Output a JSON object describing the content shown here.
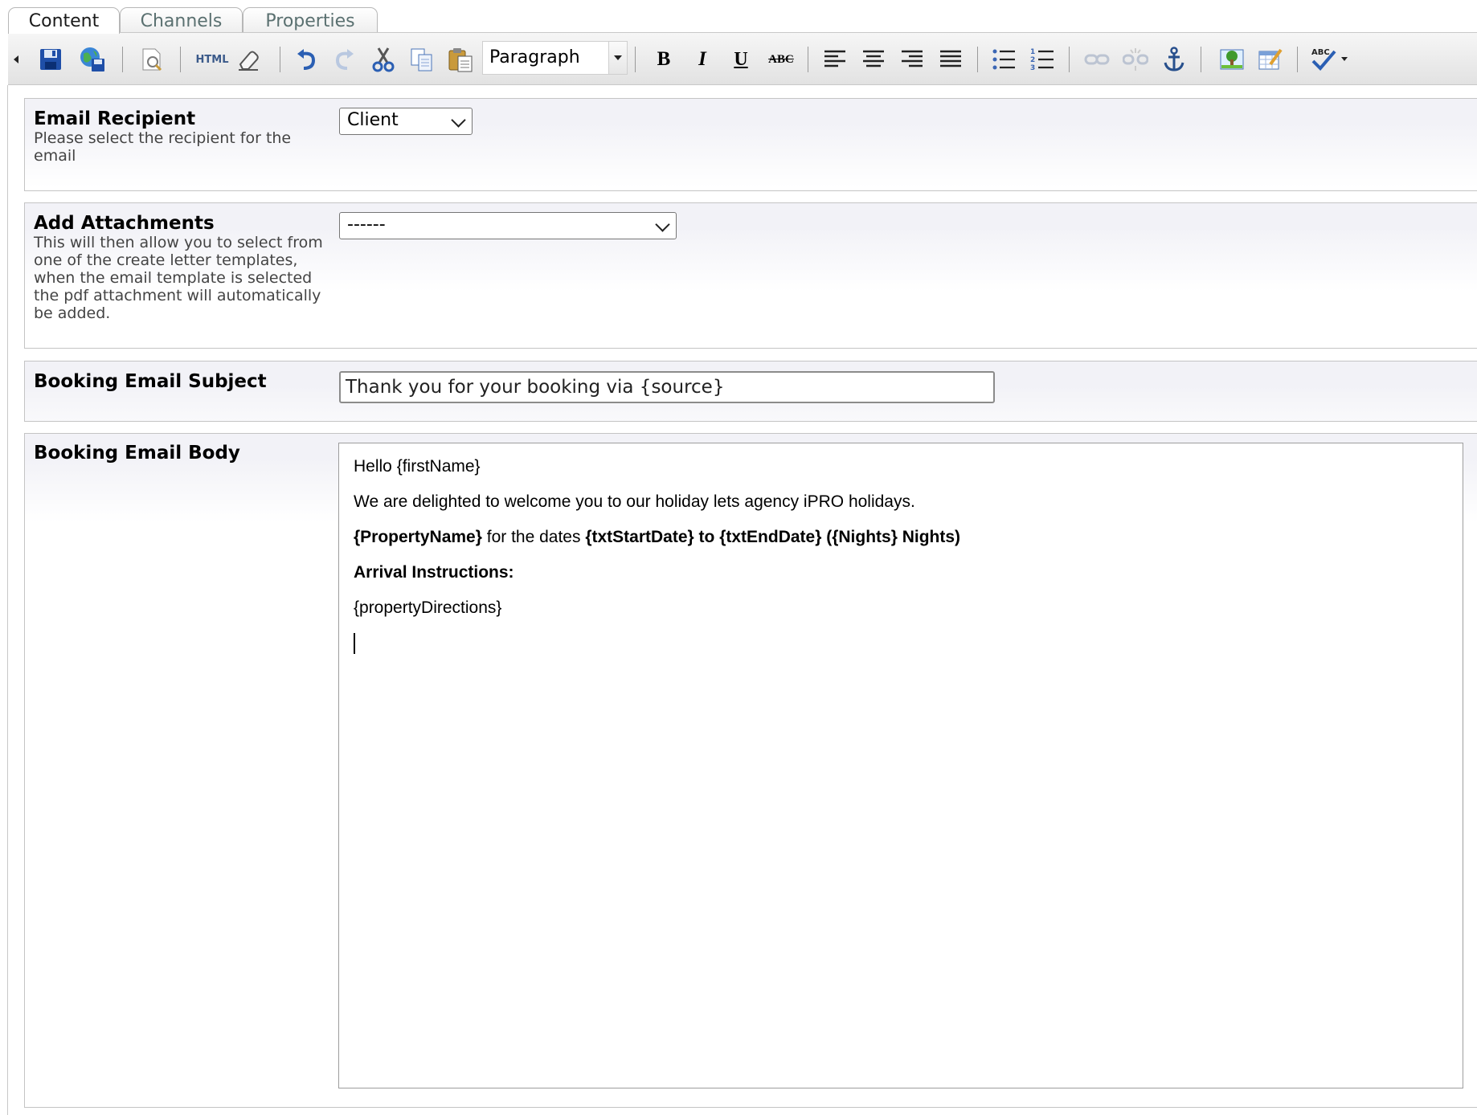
{
  "tabs": [
    {
      "label": "Content",
      "active": true
    },
    {
      "label": "Channels",
      "active": false
    },
    {
      "label": "Properties",
      "active": false
    }
  ],
  "toolbar": {
    "buttons": [
      "collapse-arrow-icon",
      "save-icon",
      "save-as-icon",
      "preview-icon",
      "html-source-icon",
      "eraser-icon",
      "undo-icon",
      "redo-icon",
      "cut-icon",
      "copy-icon",
      "paste-icon",
      "bold-icon",
      "italic-icon",
      "underline-icon",
      "strikethrough-icon",
      "align-left-icon",
      "align-center-icon",
      "align-right-icon",
      "align-justify-icon",
      "bullet-list-icon",
      "numbered-list-icon",
      "link-icon",
      "unlink-icon",
      "anchor-icon",
      "image-icon",
      "edit-table-icon",
      "spellcheck-icon"
    ],
    "html_label": "HTML",
    "format_select_value": "Paragraph",
    "bold_label": "B",
    "italic_label": "I",
    "underline_label": "U",
    "strike_label": "ABC",
    "spell_label": "ABC"
  },
  "email_recipient": {
    "title": "Email Recipient",
    "description": "Please select the recipient for the email",
    "selected": "Client"
  },
  "attachments": {
    "title": "Add Attachments",
    "description": "This will then allow you to select from one of the create letter templates, when the email template is selected the pdf attachment will automatically be added.",
    "selected": "------"
  },
  "subject": {
    "title": "Booking Email Subject",
    "value": "Thank you for your booking via {source}"
  },
  "body": {
    "title": "Booking Email Body",
    "greeting": "Hello {firstName}",
    "welcome": "We are delighted to welcome you to our holiday lets agency iPRO holidays.",
    "property_name": "{PropertyName}",
    "dates_text": " for the dates ",
    "dates_bold": "{txtStartDate} to {txtEndDate} ({Nights} Nights)",
    "arrival_heading": "Arrival Instructions:",
    "directions": "{propertyDirections}"
  }
}
